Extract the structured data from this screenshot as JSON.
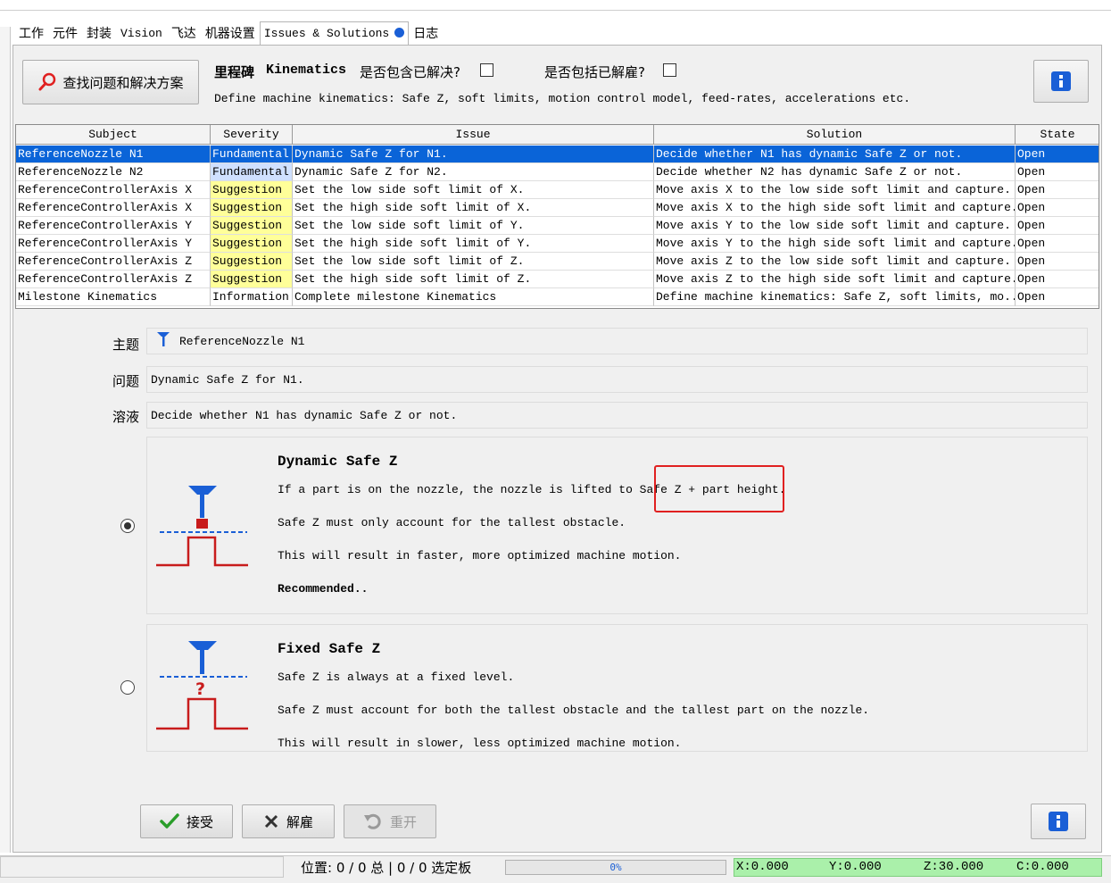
{
  "tabs": [
    {
      "label": "工作"
    },
    {
      "label": "元件"
    },
    {
      "label": "封装"
    },
    {
      "label": "Vision"
    },
    {
      "label": "飞达"
    },
    {
      "label": "机器设置"
    },
    {
      "label": "Issues & Solutions",
      "active": true
    },
    {
      "label": "日志"
    }
  ],
  "toolbar": {
    "find_button_label": "查找问题和解决方案",
    "milestone_label": "里程碑",
    "milestone_name": "Kinematics",
    "include_solved_label": "是否包含已解决?",
    "include_dismissed_label": "是否包括已解雇?",
    "milestone_description": "Define machine kinematics: Safe Z, soft limits, motion control model, feed-rates, accelerations etc."
  },
  "table": {
    "headers": [
      "Subject",
      "Severity",
      "Issue",
      "Solution",
      "State"
    ],
    "rows": [
      {
        "subject": "ReferenceNozzle N1",
        "severity": "Fundamental",
        "issue": "Dynamic Safe Z for N1.",
        "solution": "Decide whether N1 has dynamic Safe Z or not.",
        "state": "Open",
        "selected": true
      },
      {
        "subject": "ReferenceNozzle N2",
        "severity": "Fundamental",
        "issue": "Dynamic Safe Z for N2.",
        "solution": "Decide whether N2 has dynamic Safe Z or not.",
        "state": "Open"
      },
      {
        "subject": "ReferenceControllerAxis X",
        "severity": "Suggestion",
        "issue": "Set the low side soft limit of X.",
        "solution": "Move axis X to the low side soft limit and capture.",
        "state": "Open"
      },
      {
        "subject": "ReferenceControllerAxis X",
        "severity": "Suggestion",
        "issue": "Set the high side soft limit of X.",
        "solution": "Move axis X to the high side soft limit and capture.",
        "state": "Open"
      },
      {
        "subject": "ReferenceControllerAxis Y",
        "severity": "Suggestion",
        "issue": "Set the low side soft limit of Y.",
        "solution": "Move axis Y to the low side soft limit and capture.",
        "state": "Open"
      },
      {
        "subject": "ReferenceControllerAxis Y",
        "severity": "Suggestion",
        "issue": "Set the high side soft limit of Y.",
        "solution": "Move axis Y to the high side soft limit and capture.",
        "state": "Open"
      },
      {
        "subject": "ReferenceControllerAxis Z",
        "severity": "Suggestion",
        "issue": "Set the low side soft limit of Z.",
        "solution": "Move axis Z to the low side soft limit and capture.",
        "state": "Open"
      },
      {
        "subject": "ReferenceControllerAxis Z",
        "severity": "Suggestion",
        "issue": "Set the high side soft limit of Z.",
        "solution": "Move axis Z to the high side soft limit and capture.",
        "state": "Open"
      },
      {
        "subject": "Milestone Kinematics",
        "severity": "Information",
        "issue": "Complete milestone Kinematics",
        "solution": "Define machine kinematics: Safe Z, soft limits, mo...",
        "state": "Open"
      }
    ]
  },
  "details": {
    "subject_label": "主题",
    "subject_value": "ReferenceNozzle N1",
    "issue_label": "问题",
    "issue_value": "Dynamic Safe Z for N1.",
    "solution_label": "溶液",
    "solution_value": "Decide whether N1 has dynamic Safe Z or not."
  },
  "choices": {
    "dynamic": {
      "title": "Dynamic Safe Z",
      "line1a": "If a part is on the nozzle, the nozzle is lifted to Safe",
      "line1b": "Z + part height.",
      "line2": "Safe Z must only account for the tallest obstacle.",
      "line3": "This will result in faster, more optimized machine motion.",
      "line4": "Recommended..",
      "selected": true
    },
    "fixed": {
      "title": "Fixed Safe Z",
      "line1": "Safe Z is always at a fixed level.",
      "line2": "Safe Z must account for both the tallest obstacle and the tallest part on the nozzle.",
      "line3": "This will result in slower, less optimized machine motion.",
      "question_mark": "?",
      "selected": false
    }
  },
  "actions": {
    "accept_label": "接受",
    "dismiss_label": "解雇",
    "reopen_label": "重开"
  },
  "status": {
    "position_text": "位置: 0 / 0 总 | 0 / 0 选定板",
    "progress_text": "0%",
    "progress_value": 0,
    "x": "X:0.000",
    "y": "Y:0.000",
    "z": "Z:30.000",
    "c": "C:0.000"
  },
  "colors": {
    "accent_blue": "#1a5fd6",
    "selected_row": "#0a64d8",
    "fundamental_bg": "#cfe0ff",
    "suggestion_bg": "#ffff99",
    "highlight_red": "#e02020",
    "coords_bg": "#aaf0aa"
  }
}
